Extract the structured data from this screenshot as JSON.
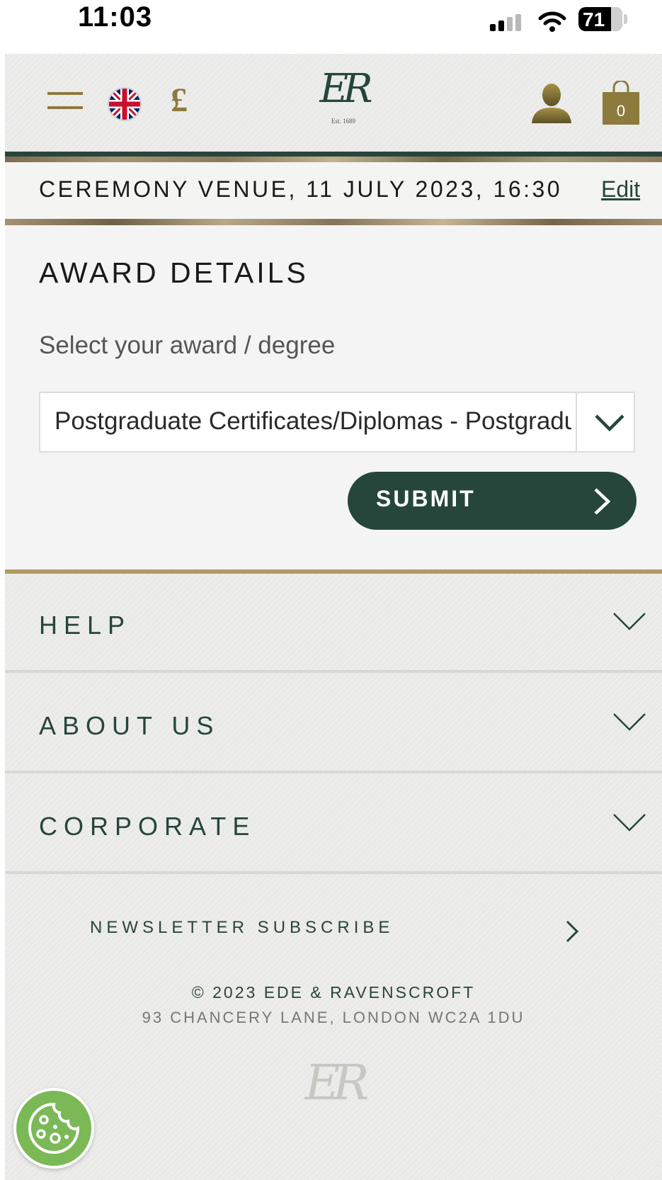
{
  "status_bar": {
    "time": "11:03",
    "battery": "71"
  },
  "header": {
    "logo_monogram": "ER",
    "logo_tagline": "Est. 1689",
    "currency_symbol": "£",
    "cart_count": "0"
  },
  "booking": {
    "venue_summary": "CEREMONY VENUE, 11 JULY 2023, 16:30",
    "edit_label": "Edit"
  },
  "award": {
    "heading": "AWARD DETAILS",
    "select_label": "Select your award / degree",
    "select_value": "Postgraduate Certificates/Diplomas - Postgraduate Certificates/Diplomas",
    "submit_label": "SUBMIT"
  },
  "footer": {
    "accordions": [
      "HELP",
      "ABOUT US",
      "CORPORATE"
    ],
    "newsletter_label": "NEWSLETTER SUBSCRIBE",
    "copyright": "© 2023 EDE & RAVENSCROFT",
    "address": "93 CHANCERY LANE, LONDON WC2A 1DU",
    "logo_monogram": "ER"
  },
  "colors": {
    "brand_green": "#26463b",
    "brand_gold": "#8d7a3d",
    "cookie_green": "#7ab955"
  },
  "icons": [
    "signal-icon",
    "wifi-icon",
    "battery-icon",
    "menu-icon",
    "uk-flag-icon",
    "currency-icon",
    "user-icon",
    "cart-icon",
    "chevron-down-icon",
    "chevron-right-icon",
    "cookie-icon"
  ]
}
